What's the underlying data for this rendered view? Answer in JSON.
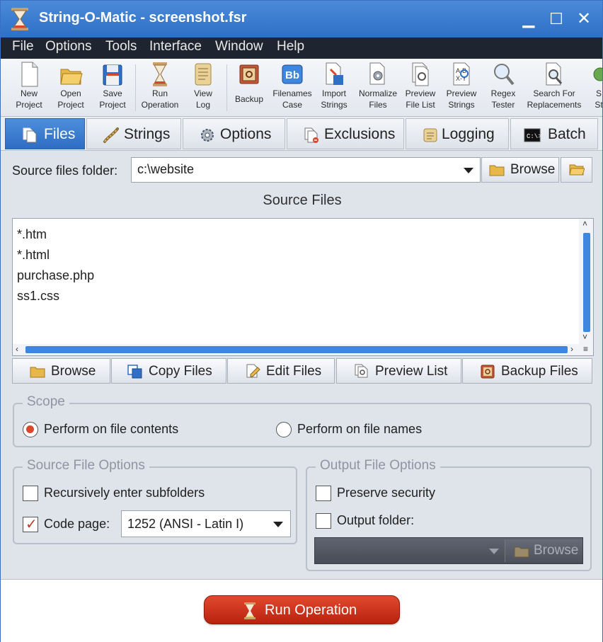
{
  "window": {
    "title": "String-O-Matic - screenshot.fsr"
  },
  "menu": [
    "File",
    "Options",
    "Tools",
    "Interface",
    "Window",
    "Help"
  ],
  "toolbar": [
    "New\nProject",
    "Open\nProject",
    "Save\nProject",
    "Run\nOperation",
    "View\nLog",
    "Backup",
    "Filenames\nCase",
    "Import\nStrings",
    "Normalize\nFiles",
    "Preview\nFile List",
    "Preview\nStrings",
    "Regex\nTester",
    "Search For\nReplacements",
    "S\nSt"
  ],
  "tabs": [
    "Files",
    "Strings",
    "Options",
    "Exclusions",
    "Logging",
    "Batch"
  ],
  "source": {
    "folder_label": "Source files folder:",
    "folder_value": "c:\\website",
    "browse_label": "Browse",
    "section_title": "Source Files",
    "files": [
      "*.htm",
      "*.html",
      "purchase.php",
      "ss1.css"
    ]
  },
  "actions": [
    "Browse",
    "Copy Files",
    "Edit Files",
    "Preview List",
    "Backup Files"
  ],
  "scope": {
    "title": "Scope",
    "contents": "Perform on file contents",
    "names": "Perform on file names"
  },
  "source_options": {
    "title": "Source File Options",
    "recursive": "Recursively enter subfolders",
    "codepage_label": "Code page:",
    "codepage_value": "1252 (ANSI - Latin I)"
  },
  "output_options": {
    "title": "Output File Options",
    "preserve": "Preserve security",
    "folder_label": "Output folder:",
    "browse_label": "Browse"
  },
  "run": {
    "label": "Run Operation"
  },
  "colors": {
    "accent": "#2f6fc6",
    "menubar": "#1f2530",
    "run": "#c8321c"
  }
}
